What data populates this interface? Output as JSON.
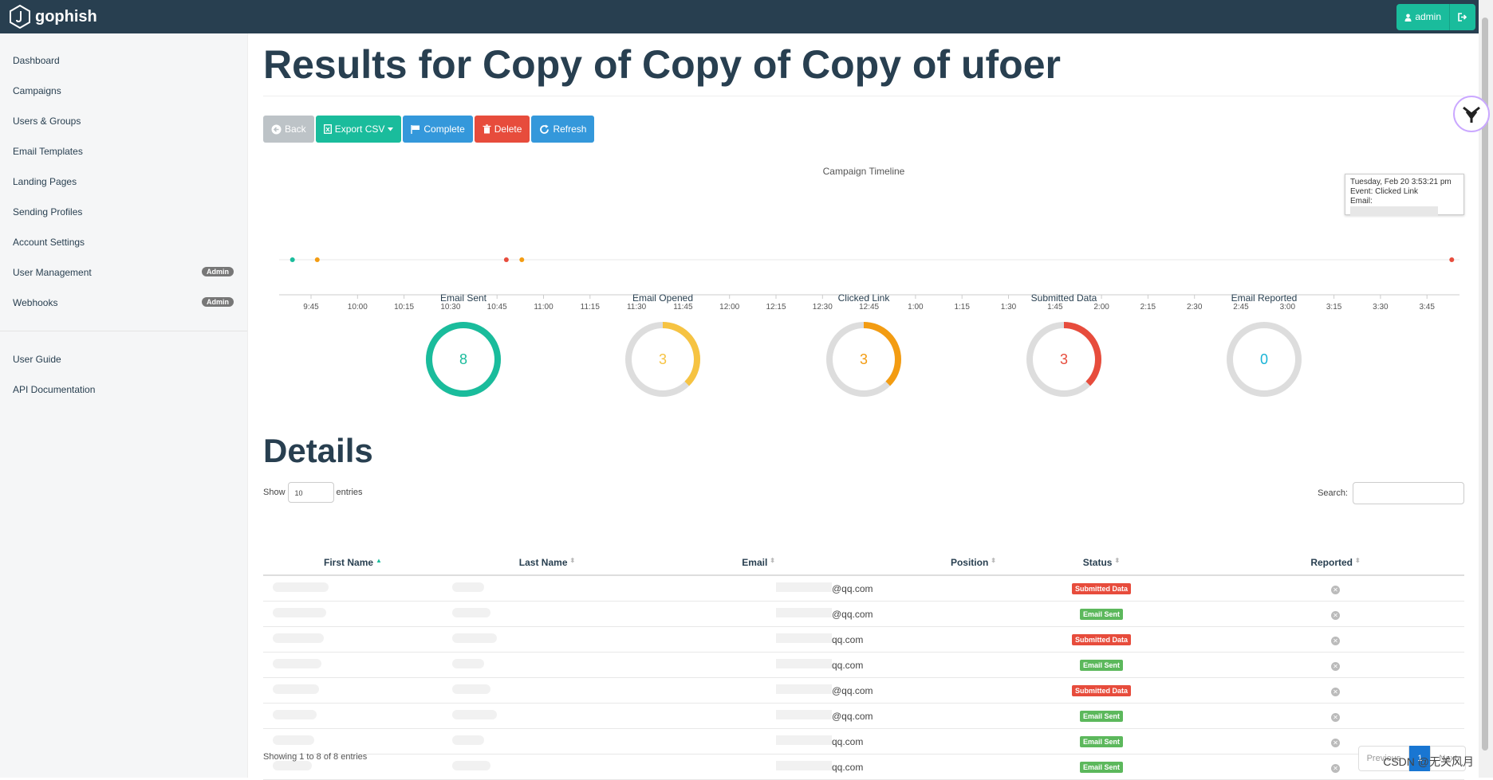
{
  "app": {
    "brand": "gophish"
  },
  "topbar": {
    "user_label": "admin",
    "user_icon": "user-icon",
    "logout_icon": "sign-out-icon"
  },
  "sidebar": {
    "items": [
      {
        "label": "Dashboard"
      },
      {
        "label": "Campaigns"
      },
      {
        "label": "Users & Groups"
      },
      {
        "label": "Email Templates"
      },
      {
        "label": "Landing Pages"
      },
      {
        "label": "Sending Profiles"
      },
      {
        "label": "Account Settings"
      },
      {
        "label": "User Management",
        "badge": "Admin"
      },
      {
        "label": "Webhooks",
        "badge": "Admin"
      }
    ],
    "secondary": [
      {
        "label": "User Guide"
      },
      {
        "label": "API Documentation"
      }
    ]
  },
  "page": {
    "title": "Results for Copy of Copy of Copy of ufoer"
  },
  "actions": {
    "back": "Back",
    "export": "Export CSV",
    "complete": "Complete",
    "delete": "Delete",
    "refresh": "Refresh"
  },
  "timeline": {
    "title": "Campaign Timeline",
    "ticks": [
      "9:45",
      "10:00",
      "10:15",
      "10:30",
      "10:45",
      "11:00",
      "11:15",
      "11:30",
      "11:45",
      "12:00",
      "12:15",
      "12:30",
      "12:45",
      "1:00",
      "1:15",
      "1:30",
      "1:45",
      "2:00",
      "2:15",
      "2:30",
      "2:45",
      "3:00",
      "3:15",
      "3:30",
      "3:45"
    ],
    "events": [
      {
        "time": "9:39",
        "color": "#1abc9c"
      },
      {
        "time": "9:47",
        "color": "#f39c12"
      },
      {
        "time": "10:48",
        "color": "#e74c3c"
      },
      {
        "time": "10:53",
        "color": "#f39c12"
      },
      {
        "time": "3:53",
        "color": "#e74c3c"
      }
    ],
    "tooltip": {
      "date": "Tuesday, Feb 20 3:53:21 pm",
      "event": "Event: Clicked Link",
      "email_label": "Email:"
    }
  },
  "stats": [
    {
      "label": "Email Sent",
      "value": "8",
      "fraction": 1.0,
      "color": "#1abc9c"
    },
    {
      "label": "Email Opened",
      "value": "3",
      "fraction": 0.375,
      "color": "#f6c342"
    },
    {
      "label": "Clicked Link",
      "value": "3",
      "fraction": 0.375,
      "color": "#f39c12"
    },
    {
      "label": "Submitted Data",
      "value": "3",
      "fraction": 0.375,
      "color": "#e74c3c"
    },
    {
      "label": "Email Reported",
      "value": "0",
      "fraction": 0.0,
      "color": "#17b3d6"
    }
  ],
  "details": {
    "title": "Details",
    "show_label": "Show",
    "show_value": "10",
    "entries_label": "entries",
    "search_label": "Search:",
    "columns": [
      "First Name",
      "Last Name",
      "Email",
      "Position",
      "Status",
      "Reported"
    ],
    "rows": [
      {
        "email": "@qq.com",
        "status": "Submitted Data"
      },
      {
        "email": "@qq.com",
        "status": "Email Sent"
      },
      {
        "email": "qq.com",
        "status": "Submitted Data"
      },
      {
        "email": "qq.com",
        "status": "Email Sent"
      },
      {
        "email": "@qq.com",
        "status": "Submitted Data"
      },
      {
        "email": "@qq.com",
        "status": "Email Sent"
      },
      {
        "email": "qq.com",
        "status": "Email Sent"
      },
      {
        "email": "qq.com",
        "status": "Email Sent"
      }
    ],
    "showing": "Showing 1 to 8 of 8 entries",
    "pager": {
      "prev": "Previous",
      "current": "1",
      "next": "Next"
    }
  },
  "watermark": "CSDN @无关风月"
}
